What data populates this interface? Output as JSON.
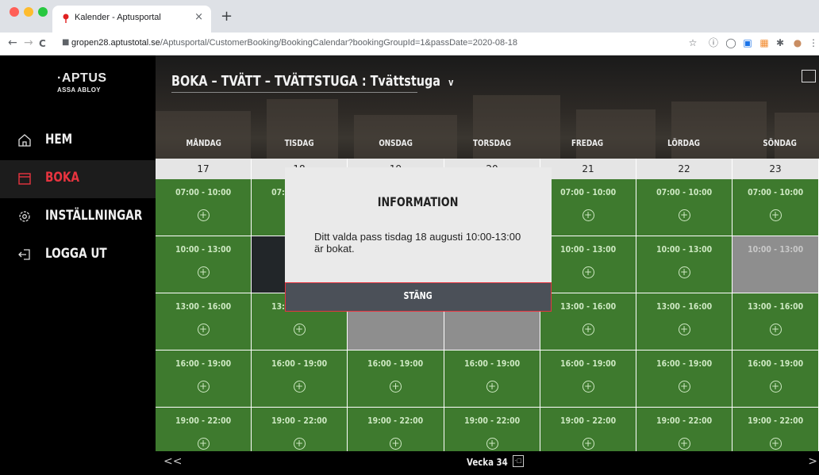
{
  "browser": {
    "tab_title": "Kalender - Aptusportal",
    "tab_close": "×",
    "new_tab": "+",
    "url_host": "gropen28.aptustotal.se",
    "url_path": "/Aptusportal/CustomerBooking/BookingCalendar?bookingGroupId=1&passDate=2020-08-18",
    "back": "←",
    "forward": "→",
    "reload": "C",
    "lock": "🔒",
    "extensions": [
      "☆",
      "ⓘ",
      "◯",
      "▣",
      "▦",
      "✱",
      "●",
      "⋮"
    ]
  },
  "sidebar": {
    "logo_main": "·APTUS",
    "logo_sub": "ASSA ABLOY",
    "items": [
      {
        "label": "HEM",
        "icon": "home-icon"
      },
      {
        "label": "BOKA",
        "icon": "calendar-icon",
        "active": true
      },
      {
        "label": "INSTÄLLNINGAR",
        "icon": "gear-icon"
      },
      {
        "label": "LOGGA UT",
        "icon": "logout-icon"
      }
    ],
    "accent_color": "#e8343f"
  },
  "header": {
    "title": "BOKA – TVÄTT – TVÄTTSTUGA : Tvättstuga",
    "dropdown_caret": "v"
  },
  "calendar": {
    "days": [
      "MÅNDAG",
      "TISDAG",
      "ONSDAG",
      "TORSDAG",
      "FREDAG",
      "LÖRDAG",
      "SÖNDAG"
    ],
    "dates": [
      "17",
      "18",
      "19",
      "20",
      "21",
      "22",
      "23"
    ],
    "slot_times": [
      "07:00 - 10:00",
      "10:00 - 13:00",
      "13:00 - 16:00",
      "16:00 - 19:00",
      "19:00 - 22:00"
    ],
    "plus": "+",
    "colors": {
      "available": "#3e7a2e",
      "unavailable": "#8e8e8e",
      "booked": "#222629"
    }
  },
  "footer": {
    "prev": "<<",
    "next": ">",
    "week_label": "Vecka 34",
    "week_icon": "-□"
  },
  "modal": {
    "title": "INFORMATION",
    "message": "Ditt valda pass tisdag 18 augusti 10:00-13:00 är bokat.",
    "close_label": "STÄNG"
  }
}
